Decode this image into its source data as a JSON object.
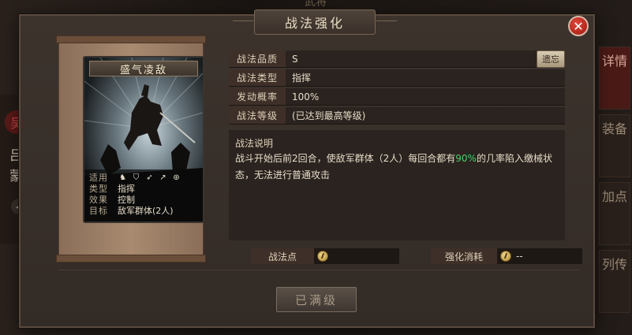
{
  "background": {
    "top_title": "武将",
    "left_emblem": "吴",
    "left_general_name": "吕蒙",
    "left_arrow_icon": "chevron-left-icon",
    "right_tabs": [
      "详情",
      "装备",
      "加点",
      "列传"
    ]
  },
  "dialog": {
    "title": "战法强化",
    "close_icon": "close-icon"
  },
  "card": {
    "name": "盛气凌敌",
    "rows": [
      {
        "key": "适用",
        "icons": [
          "cavalry-icon",
          "shield-icon",
          "bow-icon",
          "spear-icon",
          "vehicle-icon"
        ]
      },
      {
        "key": "类型",
        "value": "指挥"
      },
      {
        "key": "效果",
        "value": "控制"
      },
      {
        "key": "目标",
        "value": "敌军群体(2人)"
      }
    ]
  },
  "attributes": [
    {
      "key": "战法品质",
      "value": "S"
    },
    {
      "key": "战法类型",
      "value": "指挥"
    },
    {
      "key": "发动概率",
      "value": "100%"
    },
    {
      "key": "战法等级",
      "value": "(已达到最高等级)"
    }
  ],
  "reset_button": "遗忘",
  "description": {
    "label": "战法说明",
    "text_before": "战斗开始后前2回合，使敌军群体（2人）每回合都有",
    "highlight": "90%",
    "text_after": "的几率陷入缴械状态，无法进行普通攻击"
  },
  "costs": {
    "points_label": "战法点",
    "points_value": "",
    "enhance_label": "强化消耗",
    "enhance_value": "--"
  },
  "maxed_button": "已满级",
  "colors": {
    "highlight": "#4cd06a",
    "close_red": "#c8281c"
  }
}
